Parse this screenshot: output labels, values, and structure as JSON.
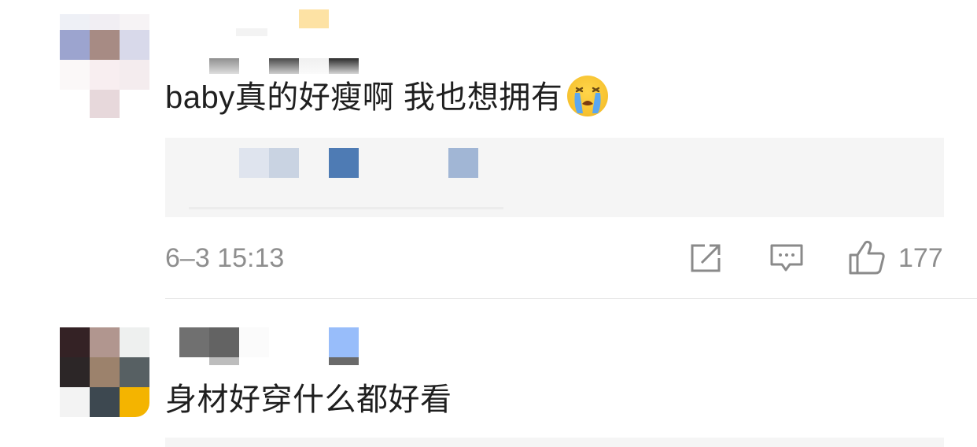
{
  "comments": [
    {
      "text": "baby真的好瘦啊 我也想拥有",
      "emoji": "loudly-crying-face",
      "timestamp": "6–3 15:13",
      "like_count": "177",
      "actions": {
        "repost_icon": "share-out-icon",
        "comment_icon": "comment-bubble-icon",
        "like_icon": "thumbs-up-icon"
      }
    },
    {
      "text": "身材好穿什么都好看"
    }
  ],
  "colors": {
    "text": "#1f1f1f",
    "meta": "#8e8e8e",
    "repost_bg": "#f5f5f5",
    "divider": "#e3e3e3"
  }
}
